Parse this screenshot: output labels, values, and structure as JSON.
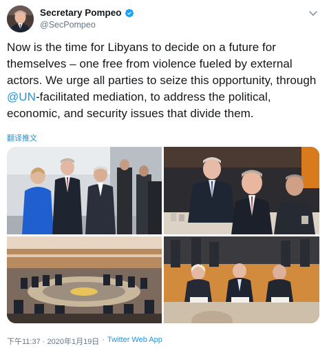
{
  "author": {
    "display_name": "Secretary Pompeo",
    "handle": "@SecPompeo",
    "verified": true
  },
  "tweet": {
    "text_part1": "Now is the time for Libyans to decide on a future for themselves – one free from violence fueled by external actors. We urge all parties to seize this opportunity, through ",
    "mention": "@UN",
    "text_part2": "-facilitated mediation, to address the political, economic, and security issues that divide them.",
    "translate_label": "翻译推文"
  },
  "media": {
    "count": 4
  },
  "footer": {
    "timestamp": "下午11:37 · 2020年1月19日",
    "separator": "·",
    "source": "Twitter Web App"
  },
  "colors": {
    "link": "#1b95e0",
    "text": "#14171a",
    "muted": "#657786"
  }
}
